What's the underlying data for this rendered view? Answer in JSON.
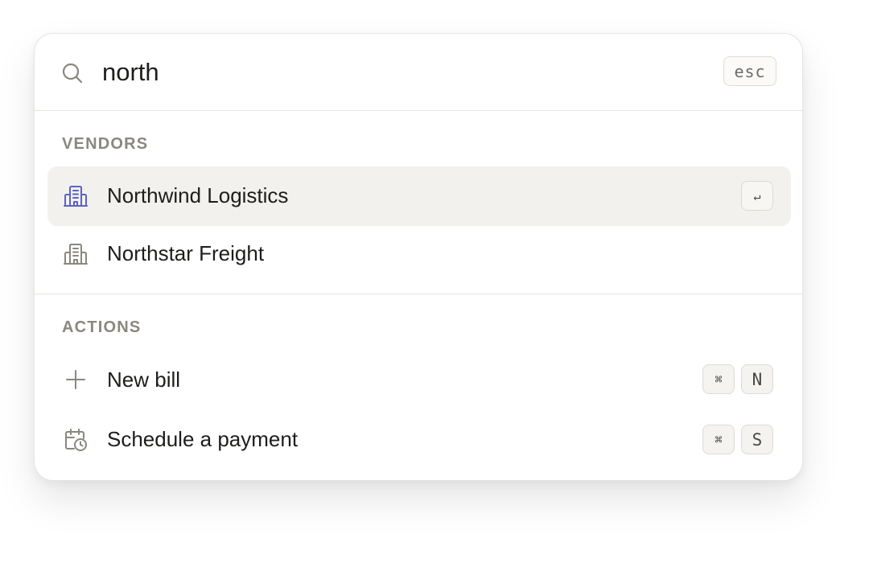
{
  "search": {
    "query": "north",
    "esc_label": "esc"
  },
  "vendors": {
    "heading": "VENDORS",
    "items": [
      {
        "label": "Northwind Logistics",
        "icon": "building-icon",
        "shortcut": "↵",
        "active": true
      },
      {
        "label": "Northstar Freight",
        "icon": "building-icon"
      }
    ]
  },
  "actions": {
    "heading": "ACTIONS",
    "items": [
      {
        "label": "New bill",
        "icon": "plus-icon",
        "shortcut_modifier": "⌘",
        "shortcut_key": "N"
      },
      {
        "label": "Schedule a payment",
        "icon": "calendar-clock-icon",
        "shortcut_modifier": "⌘",
        "shortcut_key": "S"
      }
    ]
  },
  "colors": {
    "active_icon": "#5b63c9",
    "muted_icon": "#8a877e",
    "active_row_bg": "#f2f1ee"
  }
}
